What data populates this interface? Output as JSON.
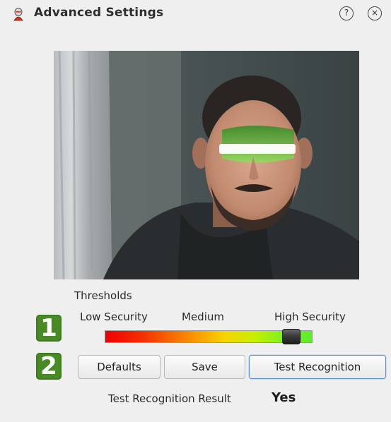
{
  "window": {
    "title": "Advanced Settings",
    "help_glyph": "?",
    "close_glyph": "×",
    "app_icon": "face-app-icon"
  },
  "camera_preview": {
    "description_icon": "camera-preview-image",
    "overlay_color": "#3fb33a"
  },
  "thresholds": {
    "label": "Thresholds",
    "ticks": [
      "Low Security",
      "Medium",
      "High Security"
    ],
    "level_fraction": 0.9,
    "gradient_colors": [
      "#f00000",
      "#f88a00",
      "#f7d500",
      "#5eec2a"
    ]
  },
  "badges": [
    "1",
    "2"
  ],
  "buttons": {
    "defaults": "Defaults",
    "save": "Save",
    "test": "Test Recognition"
  },
  "result": {
    "label": "Test Recognition Result",
    "value": "Yes"
  },
  "colors": {
    "badge": "#4a8a26",
    "focus_border": "#5b8fd0"
  }
}
